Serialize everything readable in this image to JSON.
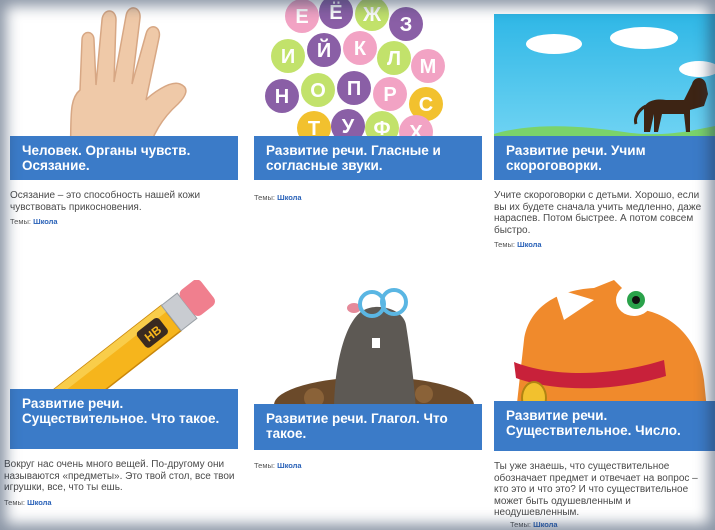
{
  "tags_label": "Темы:",
  "tag_link": "Школа",
  "cards": [
    {
      "title": "Человек. Органы чувств. Осязание.",
      "description": "Осязание – это способность нашей кожи чувствовать прикосновения."
    },
    {
      "title": "Развитие речи. Гласные и согласные звуки.",
      "description": ""
    },
    {
      "title": "Развитие речи. Учим скороговорки.",
      "description": "Учите скороговорки с детьми. Хорошо, если вы их будете сначала учить медленно, даже нараспев. Потом быстрее. А потом совсем быстро."
    },
    {
      "title": "Развитие речи. Существительное. Что такое.",
      "description": "Вокруг нас очень много вещей. По-другому они называются «предметы». Это твой стол, все твои игрушки, все, что ты ешь."
    },
    {
      "title": "Развитие речи. Глагол. Что такое.",
      "description": ""
    },
    {
      "title": "Развитие речи. Существительное. Число.",
      "description": "Ты уже знаешь, что существительное обозначает предмет и отвечает на вопрос – кто это и что это? И что существительное может быть одушевленным и неодушевленным."
    }
  ],
  "letters": [
    "Е",
    "Ё",
    "Ж",
    "З",
    "И",
    "Й",
    "К",
    "Л",
    "М",
    "Н",
    "О",
    "П",
    "Р",
    "С",
    "Т",
    "У",
    "Ф",
    "Х"
  ],
  "pencil_mark": "HB"
}
